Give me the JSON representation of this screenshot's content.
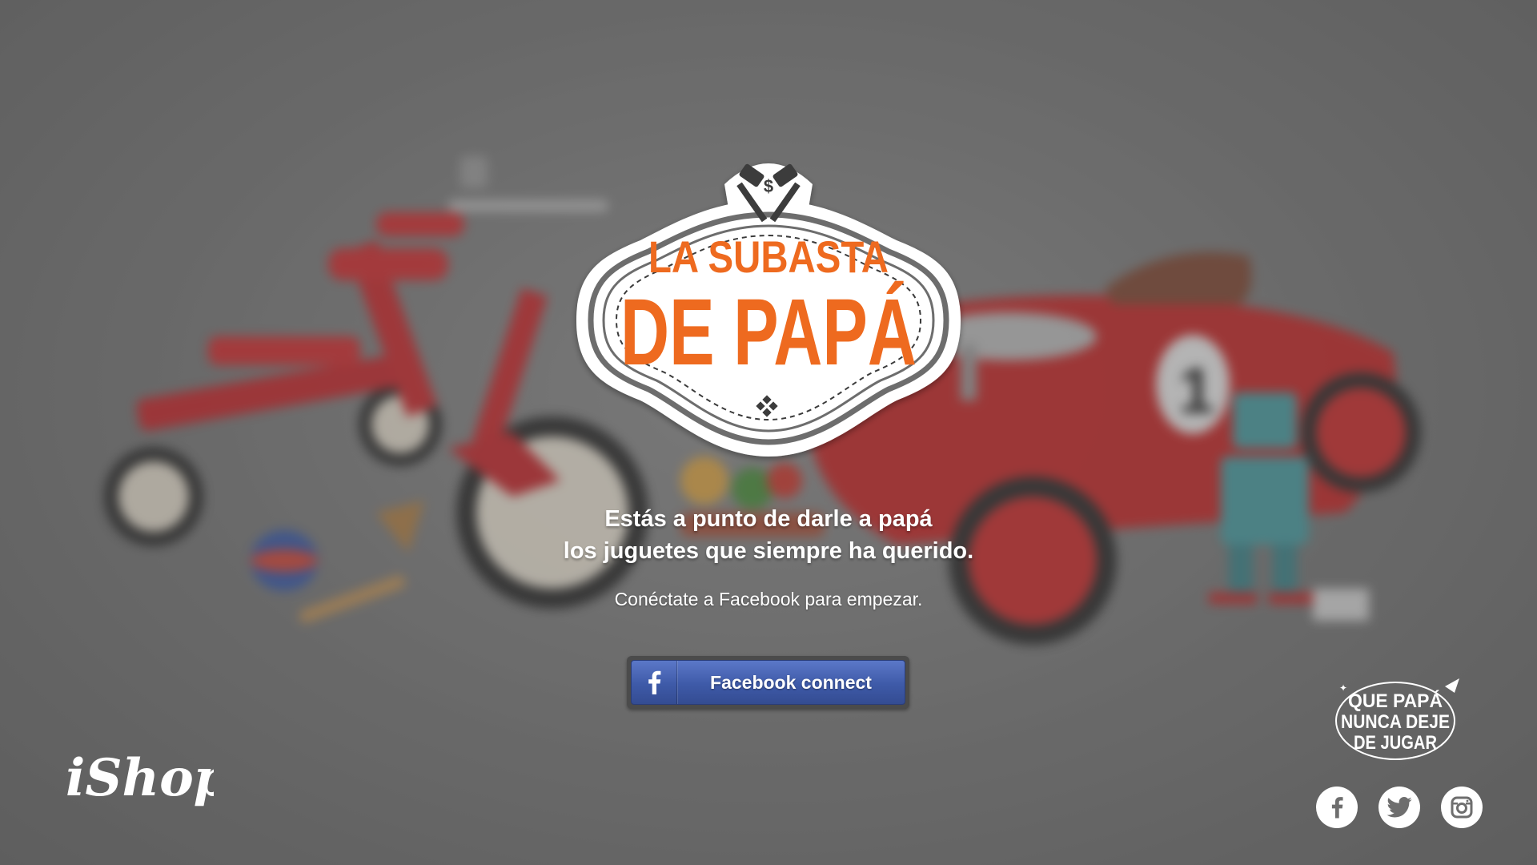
{
  "logo": {
    "line1": "LA SUBASTA",
    "line2": "DE PAPÁ",
    "dollar_sign": "$"
  },
  "headline": {
    "line1": "Estás a punto de darle a papá",
    "line2": "los juguetes que siempre ha querido."
  },
  "subline": "Conéctate a Facebook para empezar.",
  "facebook_button": {
    "label": "Facebook connect",
    "icon": "facebook-f-icon"
  },
  "footer": {
    "ishop_logo": "iShop",
    "tagline": [
      "QUE PAPÁ",
      "NUNCA DEJE",
      "DE JUGAR"
    ],
    "social_icons": [
      "facebook-icon",
      "twitter-icon",
      "instagram-icon"
    ]
  },
  "colors": {
    "logo_orange": "#ee6a1f",
    "facebook_blue": "#3e5aa8",
    "toy_red": "#c81818"
  }
}
